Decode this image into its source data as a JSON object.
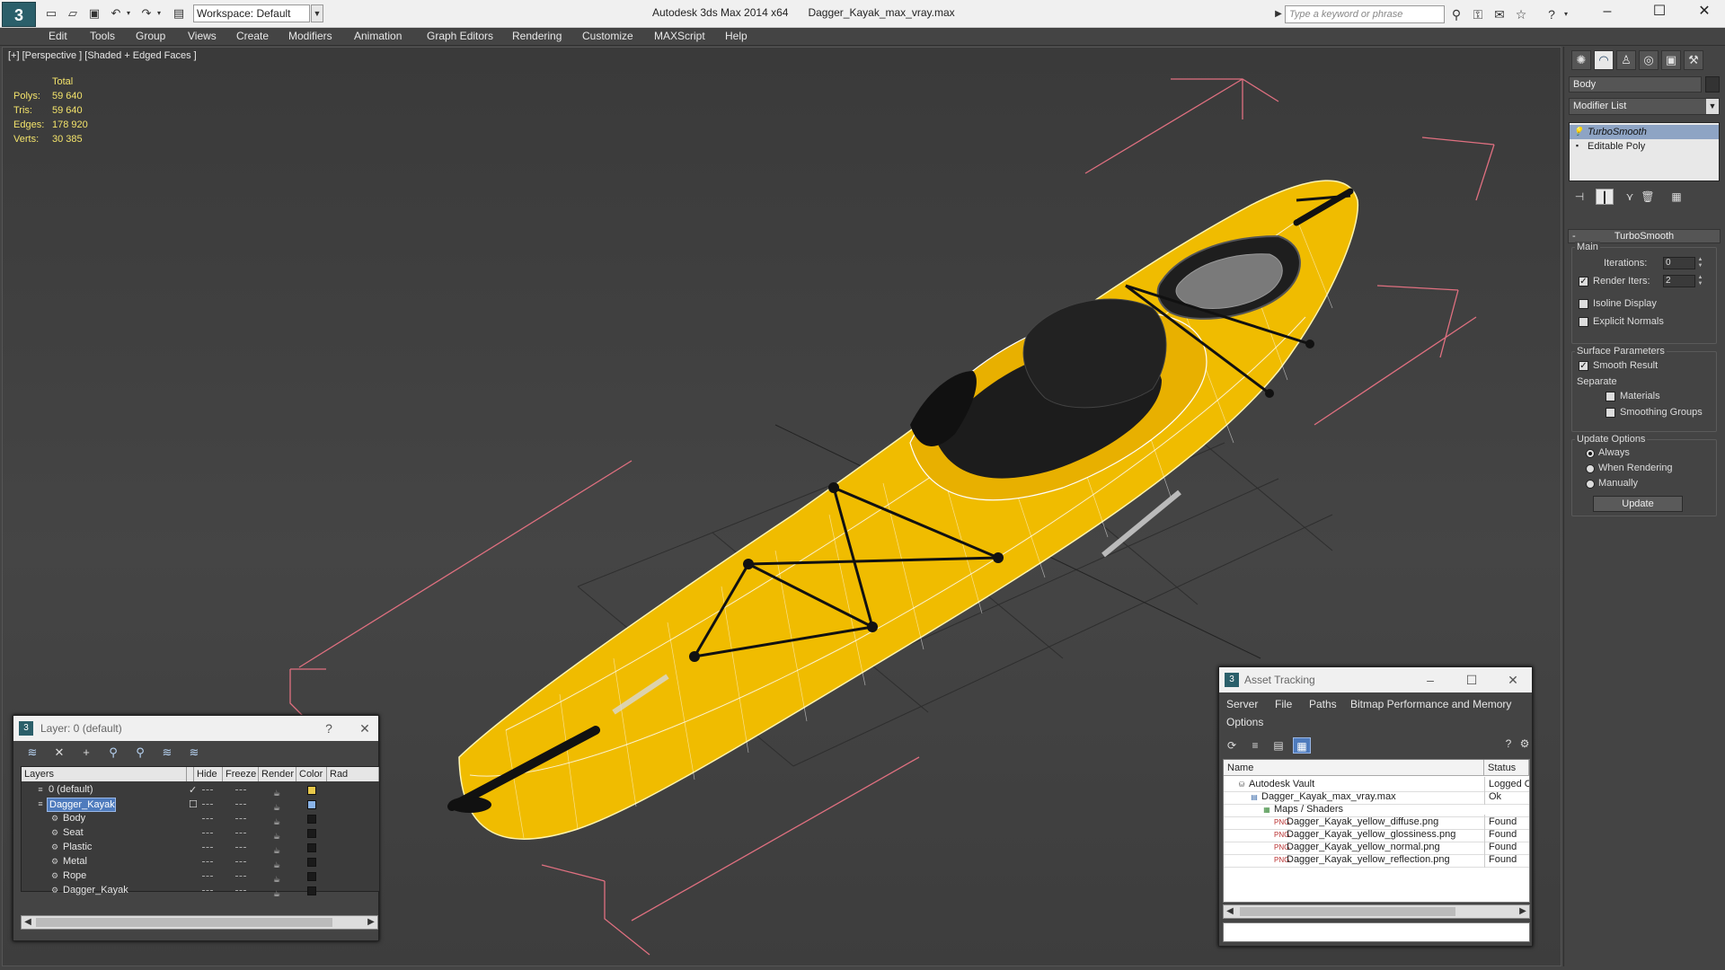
{
  "app": {
    "logo_text": "3",
    "workspace": "Workspace: Default",
    "title_app": "Autodesk 3ds Max  2014 x64",
    "title_file": "Dagger_Kayak_max_vray.max",
    "search_placeholder": "Type a keyword or phrase"
  },
  "menu": [
    "Edit",
    "Tools",
    "Group",
    "Views",
    "Create",
    "Modifiers",
    "Animation",
    "Graph Editors",
    "Rendering",
    "Customize",
    "MAXScript",
    "Help"
  ],
  "viewport": {
    "label": "[+] [Perspective ] [Shaded + Edged Faces ]",
    "stats": {
      "header": "Total",
      "rows": [
        {
          "k": "Polys:",
          "v": "59 640"
        },
        {
          "k": "Tris:",
          "v": "59 640"
        },
        {
          "k": "Edges:",
          "v": "178 920"
        },
        {
          "k": "Verts:",
          "v": "30 385"
        }
      ]
    },
    "model_color": "#f0bc00",
    "bbox_color": "#e07080",
    "grid_color": "#2e2e2e"
  },
  "command_panel": {
    "object_name": "Body",
    "modifier_list": "Modifier List",
    "stack": [
      "TurboSmooth",
      "Editable Poly"
    ],
    "turbosmooth": {
      "title": "TurboSmooth",
      "main": "Main",
      "iterations_label": "Iterations:",
      "iterations": "0",
      "render_iters_label": "Render Iters:",
      "render_iters": "2",
      "isoline": "Isoline Display",
      "explicit_normals": "Explicit Normals",
      "surface_params": "Surface Parameters",
      "smooth_result": "Smooth Result",
      "separate": "Separate",
      "materials": "Materials",
      "smoothing_groups": "Smoothing Groups",
      "update_options": "Update Options",
      "always": "Always",
      "when_rendering": "When Rendering",
      "manually": "Manually",
      "update_button": "Update"
    }
  },
  "layer_dialog": {
    "title": "Layer: 0 (default)",
    "help": "?",
    "columns": [
      "Layers",
      "Hide",
      "Freeze",
      "Render",
      "Color",
      "Rad"
    ],
    "rows": [
      {
        "name": "0 (default)",
        "indent": 0,
        "color": "#e8c84a",
        "check": "✓"
      },
      {
        "name": "Dagger_Kayak",
        "indent": 0,
        "color": "#8ab4e8",
        "check": "☐"
      },
      {
        "name": "Body",
        "indent": 1,
        "color": "#1a1a1a",
        "check": ""
      },
      {
        "name": "Seat",
        "indent": 1,
        "color": "#1a1a1a",
        "check": ""
      },
      {
        "name": "Plastic",
        "indent": 1,
        "color": "#1a1a1a",
        "check": ""
      },
      {
        "name": "Metal",
        "indent": 1,
        "color": "#1a1a1a",
        "check": ""
      },
      {
        "name": "Rope",
        "indent": 1,
        "color": "#1a1a1a",
        "check": ""
      },
      {
        "name": "Dagger_Kayak",
        "indent": 1,
        "color": "#1a1a1a",
        "check": ""
      }
    ]
  },
  "asset_dialog": {
    "title": "Asset Tracking",
    "menu": [
      "Server",
      "File",
      "Paths",
      "Bitmap Performance and Memory",
      "Options"
    ],
    "columns": [
      "Name",
      "Status"
    ],
    "rows": [
      {
        "name": "Autodesk Vault",
        "status": "Logged O",
        "indent": 0
      },
      {
        "name": "Dagger_Kayak_max_vray.max",
        "status": "Ok",
        "indent": 1
      },
      {
        "name": "Maps / Shaders",
        "status": "",
        "indent": 2
      },
      {
        "name": "Dagger_Kayak_yellow_diffuse.png",
        "status": "Found",
        "indent": 3
      },
      {
        "name": "Dagger_Kayak_yellow_glossiness.png",
        "status": "Found",
        "indent": 3
      },
      {
        "name": "Dagger_Kayak_yellow_normal.png",
        "status": "Found",
        "indent": 3
      },
      {
        "name": "Dagger_Kayak_yellow_reflection.png",
        "status": "Found",
        "indent": 3
      }
    ]
  }
}
